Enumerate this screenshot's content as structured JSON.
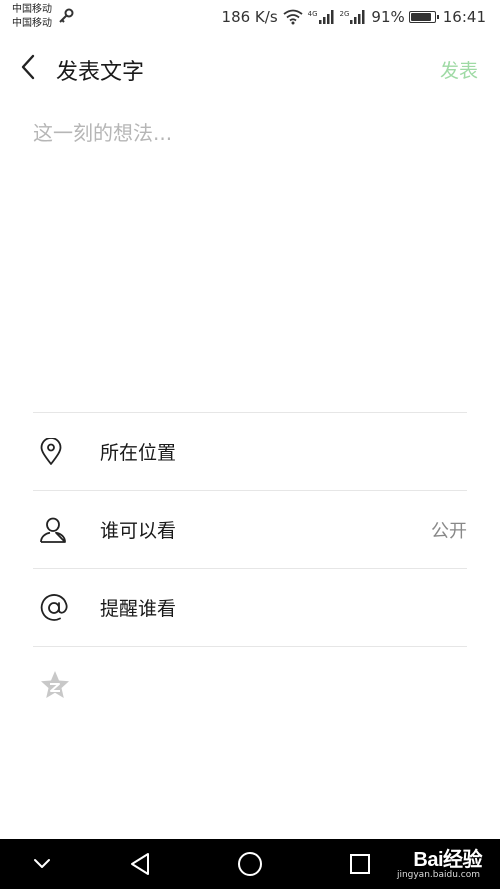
{
  "status_bar": {
    "carrier_1": "中国移动",
    "carrier_2": "中国移动",
    "net_speed": "186 K/s",
    "net_type_1": "4G",
    "net_type_2": "2G",
    "battery_percent": "91%",
    "battery_level": 0.91,
    "time": "16:41"
  },
  "header": {
    "title": "发表文字",
    "publish_label": "发表",
    "publish_color": "#9fdaa5"
  },
  "compose": {
    "value": "",
    "placeholder": "这一刻的想法..."
  },
  "options": [
    {
      "icon": "location-pin-icon",
      "label": "所在位置",
      "value": ""
    },
    {
      "icon": "person-icon",
      "label": "谁可以看",
      "value": "公开"
    },
    {
      "icon": "at-sign-icon",
      "label": "提醒谁看",
      "value": ""
    }
  ],
  "favorite_icon": "star-icon",
  "nav_bar": {
    "buttons": [
      "chevron-down-icon",
      "back-triangle-icon",
      "home-circle-icon",
      "recents-square-icon"
    ]
  },
  "watermark": {
    "logo": "Bai经验",
    "url": "jingyan.baidu.com"
  }
}
